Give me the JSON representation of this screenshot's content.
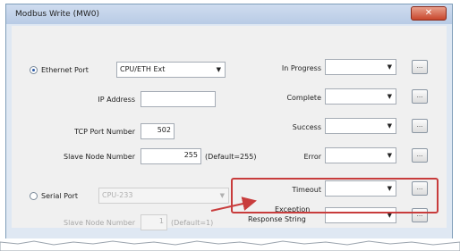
{
  "window": {
    "title": "Modbus Write (MW0)",
    "close_glyph": "✕"
  },
  "ethernet_port": {
    "label": "Ethernet Port",
    "selected": "CPU/ETH Ext",
    "checked": true
  },
  "ip_address": {
    "label": "IP Address",
    "value": ""
  },
  "tcp_port": {
    "label": "TCP Port Number",
    "value": "502"
  },
  "slave_node": {
    "label": "Slave Node Number",
    "value": "255",
    "default": "(Default=255)"
  },
  "serial_port": {
    "label": "Serial Port",
    "selected": "CPU-233",
    "checked": false
  },
  "serial_slave_node": {
    "label": "Slave Node Number",
    "value": "1",
    "default": "(Default=1)"
  },
  "outputs": [
    {
      "label": "In Progress",
      "value": ""
    },
    {
      "label": "Complete",
      "value": ""
    },
    {
      "label": "Success",
      "value": ""
    },
    {
      "label": "Error",
      "value": ""
    },
    {
      "label": "Timeout",
      "value": ""
    }
  ],
  "exception": {
    "label_line1": "Exception",
    "label_line2": "Response String",
    "value": ""
  },
  "browse_label": "...",
  "dropdown_arrow": "▼",
  "colors": {
    "highlight": "#c83c3c",
    "arrow": "#c83c3c"
  }
}
